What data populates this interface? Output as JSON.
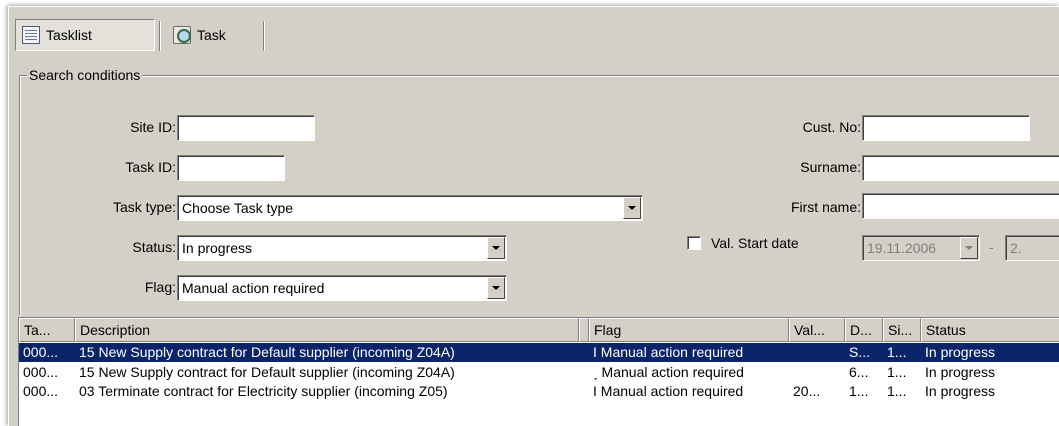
{
  "toolbar": {
    "tabs": [
      {
        "label": "Tasklist",
        "icon": "tasklist-icon",
        "pressed": true
      },
      {
        "label": "Task",
        "icon": "task-icon",
        "pressed": false
      }
    ]
  },
  "search": {
    "group_title": "Search conditions",
    "site_id": {
      "label": "Site ID:",
      "value": ""
    },
    "task_id": {
      "label": "Task ID:",
      "value": ""
    },
    "task_type": {
      "label": "Task type:",
      "value": "Choose Task type"
    },
    "status": {
      "label": "Status:",
      "value": "In progress"
    },
    "flag": {
      "label": "Flag:",
      "value": "Manual action required"
    },
    "cust_no": {
      "label": "Cust. No:",
      "value": ""
    },
    "surname": {
      "label": "Surname:",
      "value": ""
    },
    "first_name": {
      "label": "First name:",
      "value": ""
    },
    "val_start": {
      "label": "Val. Start date",
      "checked": false,
      "from": "19.11.2006",
      "separator": "-",
      "to": "2."
    }
  },
  "table": {
    "columns": [
      "Ta...",
      "Description",
      "Flag",
      "Val...",
      "D...",
      "Si...",
      "Status"
    ],
    "rows": [
      {
        "selected": true,
        "cells": [
          "000...",
          "15 New Supply contract for Default supplier (incoming Z04A)",
          "I Manual action required",
          "",
          "S...",
          "1...",
          "In progress"
        ]
      },
      {
        "selected": false,
        "cells": [
          "000...",
          "15 New Supply contract for Default supplier (incoming Z04A)",
          "ˏ Manual action required",
          "",
          "6...",
          "1...",
          "In progress"
        ]
      },
      {
        "selected": false,
        "cells": [
          "000...",
          "03 Terminate contract for Electricity supplier (incoming Z05)",
          "I Manual action required",
          "20...",
          "1...",
          "1...",
          "In progress"
        ]
      }
    ]
  }
}
